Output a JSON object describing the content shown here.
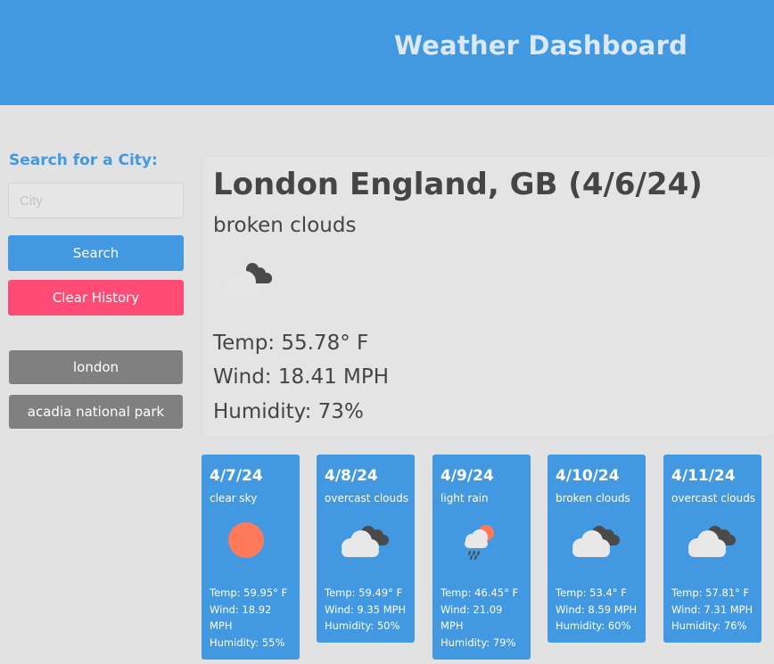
{
  "header": {
    "title": "Weather Dashboard"
  },
  "sidebar": {
    "search_label": "Search for a City:",
    "input_placeholder": "City",
    "input_value": "",
    "search_button": "Search",
    "clear_button": "Clear History",
    "history": [
      "london",
      "acadia national park"
    ]
  },
  "current": {
    "city_date": "London England, GB (4/6/24)",
    "description": "broken clouds",
    "icon": "broken-clouds-icon",
    "temp": "Temp: 55.78° F",
    "wind": "Wind: 18.41 MPH",
    "humidity": "Humidity: 73%"
  },
  "forecast": [
    {
      "date": "4/7/24",
      "description": "clear sky",
      "icon": "sun-icon",
      "temp": "Temp: 59.95° F",
      "wind": "Wind: 18.92 MPH",
      "humidity": "Humidity: 55%"
    },
    {
      "date": "4/8/24",
      "description": "overcast clouds",
      "icon": "overcast-clouds-icon",
      "temp": "Temp: 59.49° F",
      "wind": "Wind: 9.35 MPH",
      "humidity": "Humidity: 50%"
    },
    {
      "date": "4/9/24",
      "description": "light rain",
      "icon": "light-rain-icon",
      "temp": "Temp: 46.45° F",
      "wind": "Wind: 21.09 MPH",
      "humidity": "Humidity: 79%"
    },
    {
      "date": "4/10/24",
      "description": "broken clouds",
      "icon": "broken-clouds-icon",
      "temp": "Temp: 53.4° F",
      "wind": "Wind: 8.59 MPH",
      "humidity": "Humidity: 60%"
    },
    {
      "date": "4/11/24",
      "description": "overcast clouds",
      "icon": "overcast-clouds-icon",
      "temp": "Temp: 57.81° F",
      "wind": "Wind: 7.31 MPH",
      "humidity": "Humidity: 76%"
    }
  ],
  "colors": {
    "primary": "#4299e1",
    "clear": "#ff4b76",
    "history": "#808080",
    "background": "#e2e2e2",
    "sun": "#ff7a5a"
  }
}
